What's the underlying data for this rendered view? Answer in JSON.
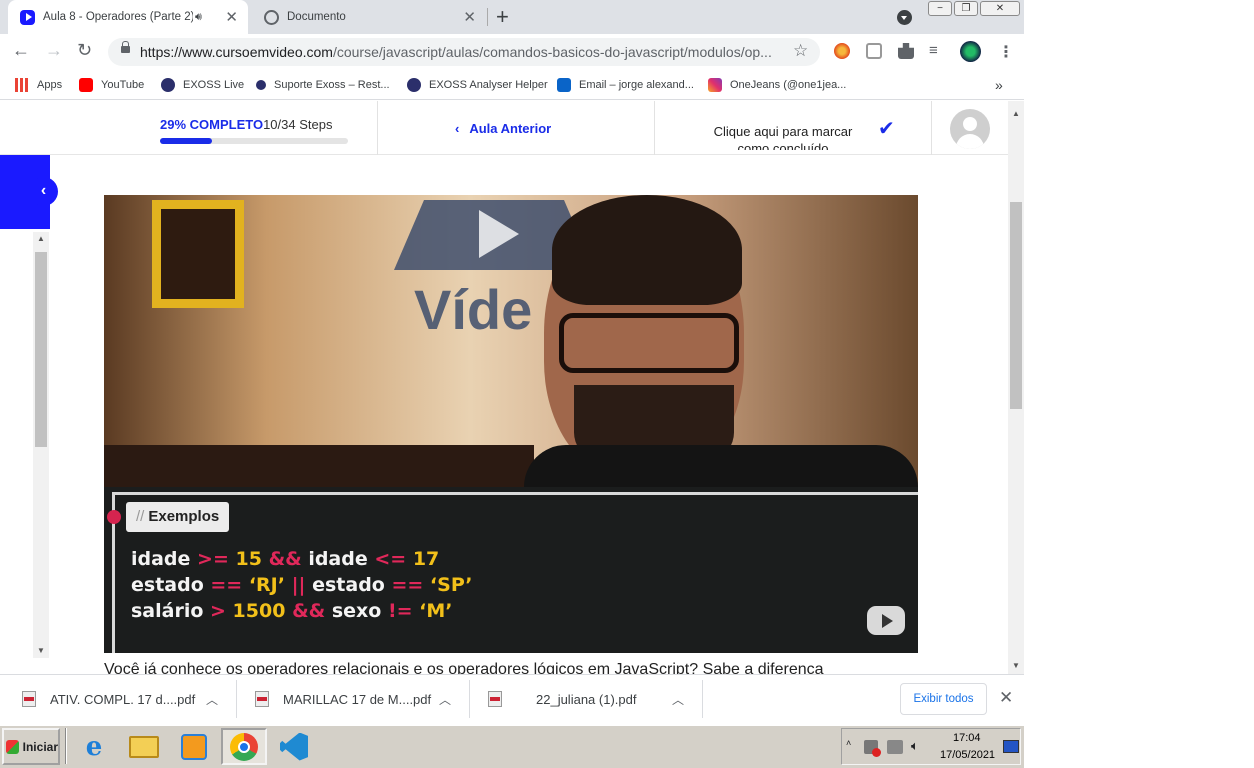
{
  "browser": {
    "tabs": [
      {
        "title": "Aula 8 - Operadores (Parte 2) -",
        "active": true,
        "audio": true
      },
      {
        "title": "Documento",
        "active": false
      }
    ],
    "url_host": "https://www.cursoemvideo.com",
    "url_path": "/course/javascript/aulas/comandos-basicos-do-javascript/modulos/op...",
    "window_controls": [
      "−",
      "❐",
      "✕"
    ],
    "bookmarks": [
      {
        "label": "Apps",
        "icon": "apps-grid-icon"
      },
      {
        "label": "YouTube",
        "icon": "youtube-icon"
      },
      {
        "label": "EXOSS Live",
        "icon": "exoss-icon"
      },
      {
        "label": "Suporte Exoss – Rest...",
        "icon": "exoss-icon"
      },
      {
        "label": "EXOSS Analyser Helper",
        "icon": "exoss-icon"
      },
      {
        "label": "Email – jorge alexand...",
        "icon": "outlook-icon"
      },
      {
        "label": "OneJeans (@one1jea...",
        "icon": "instagram-icon"
      }
    ],
    "bookmarks_overflow": "»"
  },
  "course": {
    "progress_percent_label": "29% COMPLETO",
    "progress_steps_label": "10/34 Steps",
    "progress_fraction": 0.29,
    "previous_lesson": "Aula Anterior",
    "mark_complete": "Clique aqui para marcar como concluído"
  },
  "video": {
    "logo_text": "Víde",
    "examples_tag": "Exemplos",
    "examples_prefix": "//",
    "code_lines": [
      [
        [
          "idade ",
          "t"
        ],
        [
          ">=",
          "op"
        ],
        [
          " 15 ",
          "val"
        ],
        [
          "&&",
          "op"
        ],
        [
          " idade ",
          "t"
        ],
        [
          "<=",
          "op"
        ],
        [
          " 17",
          "val"
        ]
      ],
      [
        [
          "estado ",
          "t"
        ],
        [
          "==",
          "op"
        ],
        [
          " ‘RJ’ ",
          "val"
        ],
        [
          "||",
          "op"
        ],
        [
          " estado ",
          "t"
        ],
        [
          "==",
          "op"
        ],
        [
          " ‘SP’",
          "val"
        ]
      ],
      [
        [
          "salário ",
          "t"
        ],
        [
          ">",
          "op"
        ],
        [
          " 1500 ",
          "val"
        ],
        [
          "&&",
          "op"
        ],
        [
          " sexo ",
          "t"
        ],
        [
          "!=",
          "op"
        ],
        [
          " ‘M’",
          "val"
        ]
      ]
    ]
  },
  "paragraph": "Você já conhece os operadores relacionais e os operadores lógicos em JavaScript? Sabe a diferença",
  "downloads": {
    "items": [
      "ATIV. COMPL. 17 d....pdf",
      "MARILLAC 17 de M....pdf",
      "22_juliana (1).pdf"
    ],
    "show_all": "Exibir todos"
  },
  "taskbar": {
    "start_label": "Iniciar",
    "apps": [
      "internet-explorer-icon",
      "file-explorer-icon",
      "media-player-icon",
      "chrome-icon",
      "vscode-icon"
    ],
    "time": "17:04",
    "date": "17/05/2021"
  },
  "colors": {
    "accent": "#1a2ce8",
    "sidebar_toggle": "#1a1aff",
    "operator": "#e0285a",
    "value": "#f2c01a"
  }
}
